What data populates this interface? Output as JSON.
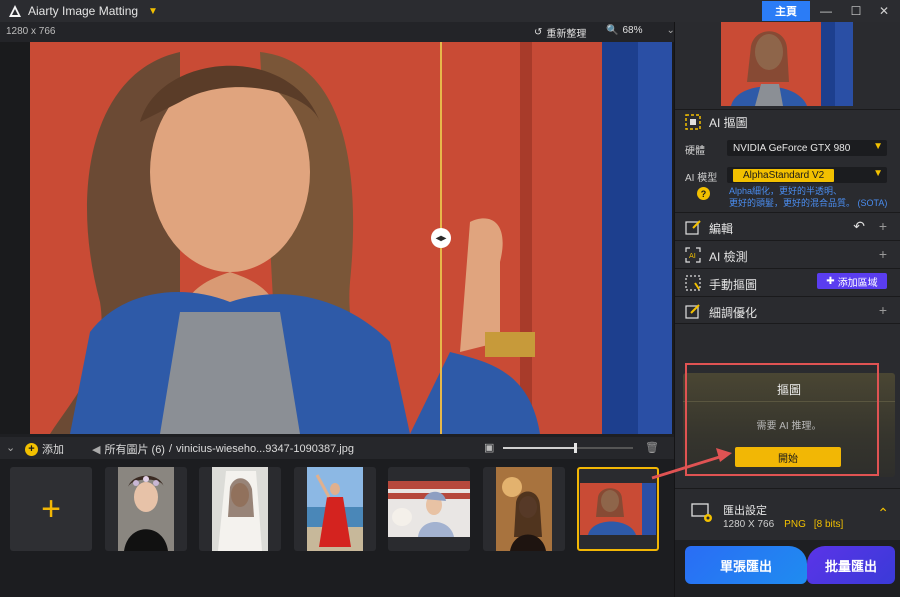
{
  "app": {
    "title": "Aiarty Image Matting",
    "home_label": "主頁"
  },
  "canvas": {
    "dimensions": "1280 x 766",
    "reset_label": "重新整理",
    "zoom": "68%"
  },
  "bottombar": {
    "add_label": "添加",
    "all_images_label": "所有圖片 (6)",
    "separator": "/",
    "file_name": "vinicius-wieseho...9347-1090387.jpg",
    "thumb_size_fraction": 0.55
  },
  "thumbnails": [
    {
      "name": "thumb-girl-flower-crown",
      "active": false
    },
    {
      "name": "thumb-bride-white",
      "active": false
    },
    {
      "name": "thumb-red-dress-beach",
      "active": false
    },
    {
      "name": "thumb-woman-with-dog",
      "active": false
    },
    {
      "name": "thumb-woman-sunset",
      "active": false
    },
    {
      "name": "thumb-woman-red-wall",
      "active": true
    }
  ],
  "panel": {
    "ai_matting": {
      "title": "AI 摳圖",
      "hardware_label": "硬體",
      "hardware_value": "NVIDIA GeForce GTX 980",
      "model_label": "AI 模型",
      "model_value": "AlphaStandard  V2",
      "description_line1": "Alpha細化，更好的半透明、",
      "description_line2": "更好的頭髮，更好的混合品質。 (SOTA)"
    },
    "edit": {
      "title": "編輯"
    },
    "ai_detect": {
      "title": "AI 檢測"
    },
    "manual_matting": {
      "title": "手動摳圖",
      "add_area_label": "添加區域"
    },
    "refine": {
      "title": "細調優化"
    },
    "matting_card": {
      "title": "摳圖",
      "message": "需要 AI 推理。",
      "start_label": "開始"
    },
    "export": {
      "title": "匯出設定",
      "dimensions": "1280 X 766",
      "format": "PNG",
      "bits": "[8 bits]",
      "single_label": "單張匯出",
      "batch_label": "批量匯出"
    }
  },
  "colors": {
    "accent_yellow": "#f2b705",
    "accent_blue": "#2b7cf6",
    "accent_purple": "#5a3df0",
    "highlight_red": "#e05353"
  }
}
